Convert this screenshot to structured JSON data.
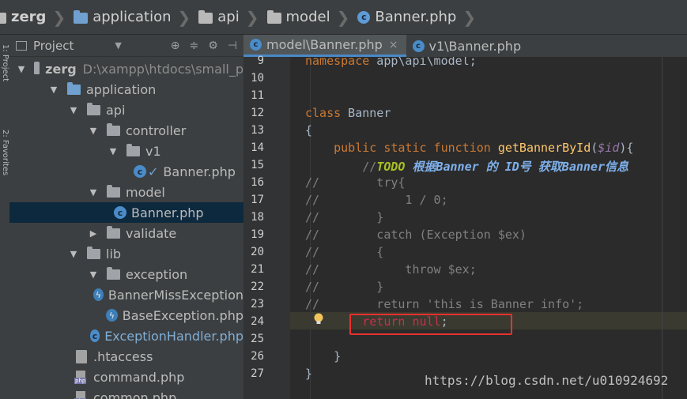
{
  "breadcrumb": [
    {
      "label": "zerg",
      "icon": "folder-icon"
    },
    {
      "label": "application",
      "icon": "folder-blue-icon"
    },
    {
      "label": "api",
      "icon": "folder-icon"
    },
    {
      "label": "model",
      "icon": "folder-icon"
    },
    {
      "label": "Banner.php",
      "icon": "php-class-icon"
    }
  ],
  "left_strip": {
    "label_top": "1: Project",
    "label_bottom": "2: Favorites"
  },
  "project_panel": {
    "title": "Project",
    "tree": [
      {
        "label": "zerg",
        "extra": "D:\\xampp\\htdocs\\small_p",
        "depth": 0,
        "arrow": "▼",
        "icon": "folder"
      },
      {
        "label": "application",
        "depth": 1,
        "arrow": "▼",
        "icon": "folder-blue"
      },
      {
        "label": "api",
        "depth": 2,
        "arrow": "▼",
        "icon": "folder"
      },
      {
        "label": "controller",
        "depth": 3,
        "arrow": "▼",
        "icon": "folder"
      },
      {
        "label": "v1",
        "depth": 4,
        "arrow": "▼",
        "icon": "folder"
      },
      {
        "label": "Banner.php",
        "depth": 5,
        "arrow": "",
        "icon": "class-v"
      },
      {
        "label": "model",
        "depth": 3,
        "arrow": "▼",
        "icon": "folder"
      },
      {
        "label": "Banner.php",
        "depth": 4,
        "arrow": "",
        "icon": "class",
        "selected": true
      },
      {
        "label": "validate",
        "depth": 3,
        "arrow": "▶",
        "icon": "folder"
      },
      {
        "label": "lib",
        "depth": 2,
        "arrow": "▼",
        "icon": "folder"
      },
      {
        "label": "exception",
        "depth": 3,
        "arrow": "▼",
        "icon": "folder"
      },
      {
        "label": "BannerMissException",
        "depth": 4,
        "arrow": "",
        "icon": "bolt"
      },
      {
        "label": "BaseException.php",
        "depth": 4,
        "arrow": "",
        "icon": "bolt"
      },
      {
        "label": "ExceptionHandler.php",
        "depth": 4,
        "arrow": "",
        "icon": "class",
        "italic": true
      },
      {
        "label": ".htaccess",
        "depth": 2,
        "arrow": "",
        "icon": "file"
      },
      {
        "label": "command.php",
        "depth": 2,
        "arrow": "",
        "icon": "php"
      },
      {
        "label": "common.php",
        "depth": 2,
        "arrow": "",
        "icon": "php"
      }
    ]
  },
  "tabs": [
    {
      "label": "model\\Banner.php",
      "active": true,
      "close": "×"
    },
    {
      "label": "v1\\Banner.php",
      "active": false
    }
  ],
  "editor": {
    "lines": [
      {
        "n": "9",
        "html": "<span class=\"kw\">namespace</span> app\\api\\model;"
      },
      {
        "n": "10",
        "html": ""
      },
      {
        "n": "11",
        "html": ""
      },
      {
        "n": "12",
        "html": "<span class=\"kw\">class</span> Banner"
      },
      {
        "n": "13",
        "html": "{"
      },
      {
        "n": "14",
        "html": "    <span class=\"kw\">public static function</span> <span class=\"fn\">getBannerById</span>(<span class=\"var\">$id</span>){"
      },
      {
        "n": "15",
        "html": "        <span class=\"cm\">//</span><span class=\"todo\">TODO</span> <span class=\"todo-cn\">根据Banner 的 ID号 获取Banner信息</span>"
      },
      {
        "n": "16",
        "html": "<span class=\"cm\">//        try{</span>"
      },
      {
        "n": "17",
        "html": "<span class=\"cm\">//            1 / 0;</span>"
      },
      {
        "n": "18",
        "html": "<span class=\"cm\">//        }</span>"
      },
      {
        "n": "19",
        "html": "<span class=\"cm\">//        catch (Exception $ex)</span>"
      },
      {
        "n": "20",
        "html": "<span class=\"cm\">//        {</span>"
      },
      {
        "n": "21",
        "html": "<span class=\"cm\">//            throw $ex;</span>"
      },
      {
        "n": "22",
        "html": "<span class=\"cm\">//        }</span>"
      },
      {
        "n": "23",
        "html": "<span class=\"cm\">//        return 'this is Banner info';</span>"
      },
      {
        "n": "24",
        "html": "        <span class=\"kw2\">return null</span>;"
      },
      {
        "n": "25",
        "html": ""
      },
      {
        "n": "26",
        "html": "    }"
      },
      {
        "n": "27",
        "html": "}"
      }
    ],
    "watermark": "https://blog.csdn.net/u010924692"
  }
}
